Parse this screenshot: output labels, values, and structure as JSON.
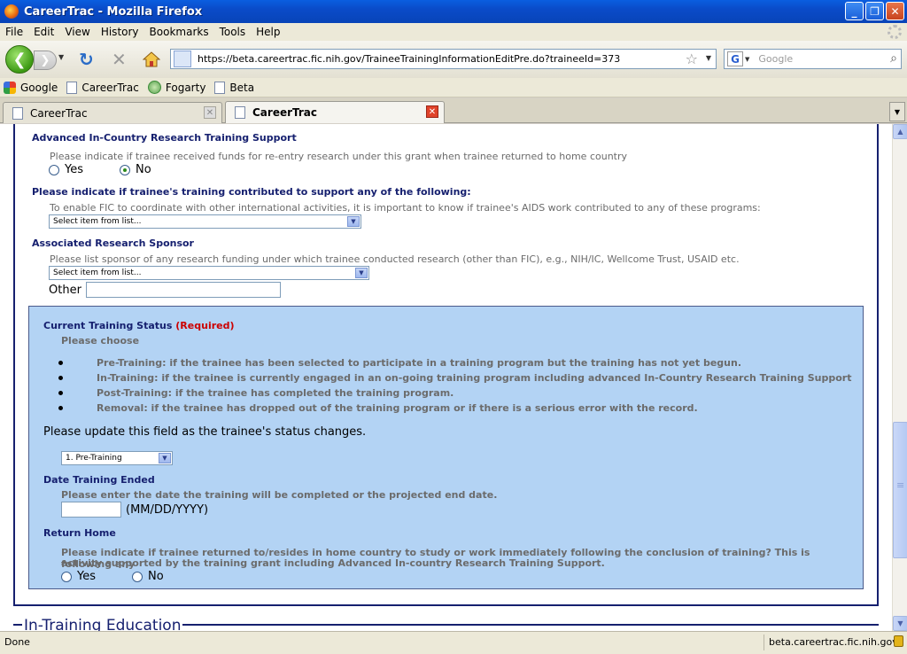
{
  "window": {
    "title": "CareerTrac - Mozilla Firefox",
    "buttons": [
      "_",
      "❐",
      "✕"
    ]
  },
  "menu": [
    "File",
    "Edit",
    "View",
    "History",
    "Bookmarks",
    "Tools",
    "Help"
  ],
  "toolbar": {
    "url": "https://beta.careertrac.fic.nih.gov/TraineeTrainingInformationEditPre.do?traineeId=373",
    "search_placeholder": "Google"
  },
  "bookmarks": [
    "Google",
    "CareerTrac",
    "Fogarty",
    "Beta"
  ],
  "tabs": [
    {
      "label": "CareerTrac",
      "active": false
    },
    {
      "label": "CareerTrac",
      "active": true
    }
  ],
  "form": {
    "advanced": {
      "title": "Advanced In-Country Research Training Support",
      "help": "Please indicate if trainee received funds for re-entry research under this grant when trainee returned to home country",
      "yes": "Yes",
      "no": "No",
      "selected": "No"
    },
    "contributed": {
      "title": "Please indicate if trainee's training contributed to support any of the following:",
      "help": "To enable FIC to coordinate with other international activities, it is important to know if trainee's AIDS work contributed to any of these programs:",
      "select_value": "Select item from list..."
    },
    "sponsor": {
      "title": "Associated Research Sponsor",
      "help": "Please list sponsor of any research funding under which trainee conducted research (other than FIC), e.g., NIH/IC, Wellcome Trust, USAID etc.",
      "select_value": "Select item from list...",
      "other_label": "Other",
      "other_value": ""
    },
    "status": {
      "title": "Current Training Status",
      "required": "(Required)",
      "choose": "Please choose",
      "bullets": [
        "Pre-Training: if the trainee has been selected to participate in a training program but the training has not yet begun.",
        "In-Training: if the trainee is currently engaged in an on-going training program including advanced In-Country Research Training Support",
        "Post-Training: if the trainee has completed the training program.",
        "Removal: if the trainee has dropped out of the training program or if there is a serious error with the record."
      ],
      "update_note": "Please update this field as the trainee's status changes.",
      "select_value": "1. Pre-Training"
    },
    "date_ended": {
      "title": "Date Training Ended",
      "help": "Please enter the date the training will be completed or the projected end date.",
      "value": "",
      "format": "(MM/DD/YYYY)"
    },
    "return_home": {
      "title": "Return Home",
      "help_line1": "Please indicate if trainee returned to/resides in home country to study or work immediately following the conclusion of training? This is following any",
      "help_line2": "activity supported by the training grant including Advanced In-country Research Training Support.",
      "yes": "Yes",
      "no": "No"
    },
    "next_section": "In-Training Education"
  },
  "status_bar": {
    "text": "Done",
    "host": "beta.careertrac.fic.nih.gov"
  }
}
